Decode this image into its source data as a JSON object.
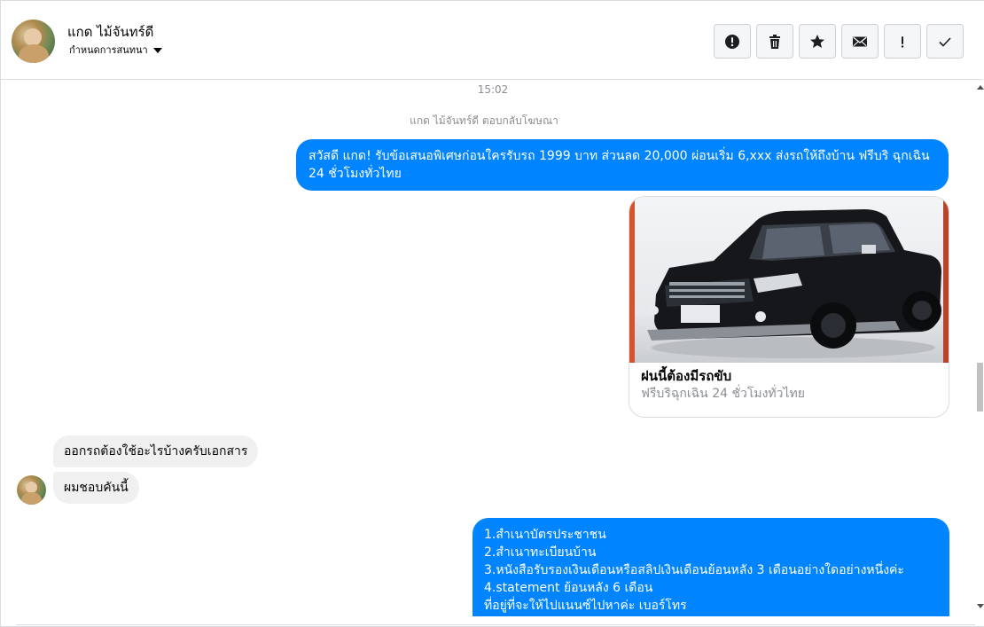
{
  "header": {
    "contact_name": "แกด ไม้จันทร์ดี",
    "subtitle": "กำหนดการสนทนา",
    "actions": [
      {
        "name": "report-button",
        "icon": "alert-circle-icon"
      },
      {
        "name": "delete-button",
        "icon": "trash-icon"
      },
      {
        "name": "star-button",
        "icon": "star-icon"
      },
      {
        "name": "mark-unread-button",
        "icon": "envelope-icon"
      },
      {
        "name": "flag-important-button",
        "icon": "exclamation-icon"
      },
      {
        "name": "mark-done-button",
        "icon": "checkmark-icon"
      }
    ]
  },
  "chat": {
    "timestamp": "15:02",
    "system_note": "แกด ไม้จันทร์ดี ตอบกลับโฆษณา",
    "messages": {
      "outgoing_promo": "สวัสดี แกด! รับข้อเสนอพิเศษก่อนใครรับรถ 1999 บาท ส่วนลด 20,000  ผ่อนเริ่ม 6,xxx ส่งรถให้ถึงบ้าน ฟรีบริ ฉุกเฉิน 24 ชั่วโมงทั่วไทย",
      "ad_card": {
        "title": "ฝนนี้ต้องมีรถขับ",
        "subtitle": "ฟรีบริฉุกเฉิน 24 ชั่วโมงทั่วไทย"
      },
      "incoming_1": "ออกรถต้องใช้อะไรบ้างครับเอกสาร",
      "incoming_2": "ผมชอบคันนี้",
      "outgoing_list": [
        "1.สำเนาบัตรประชาชน",
        "2.สำเนาทะเบียนบ้าน",
        "3.หนังสือรับรองเงินเดือนหรือสลิปเงินเดือนย้อนหลัง 3 เดือนอย่างใดอย่างหนึ่งค่ะ",
        "4.statement ย้อนหลัง 6 เดือน",
        "ที่อยู่ที่จะให้ไปแนนซ์ไปหาค่ะ เบอร์โทร"
      ]
    }
  },
  "colors": {
    "outgoing_bubble": "#0084ff",
    "incoming_bubble": "#f0f0f0",
    "muted_text": "#8a8d91"
  }
}
